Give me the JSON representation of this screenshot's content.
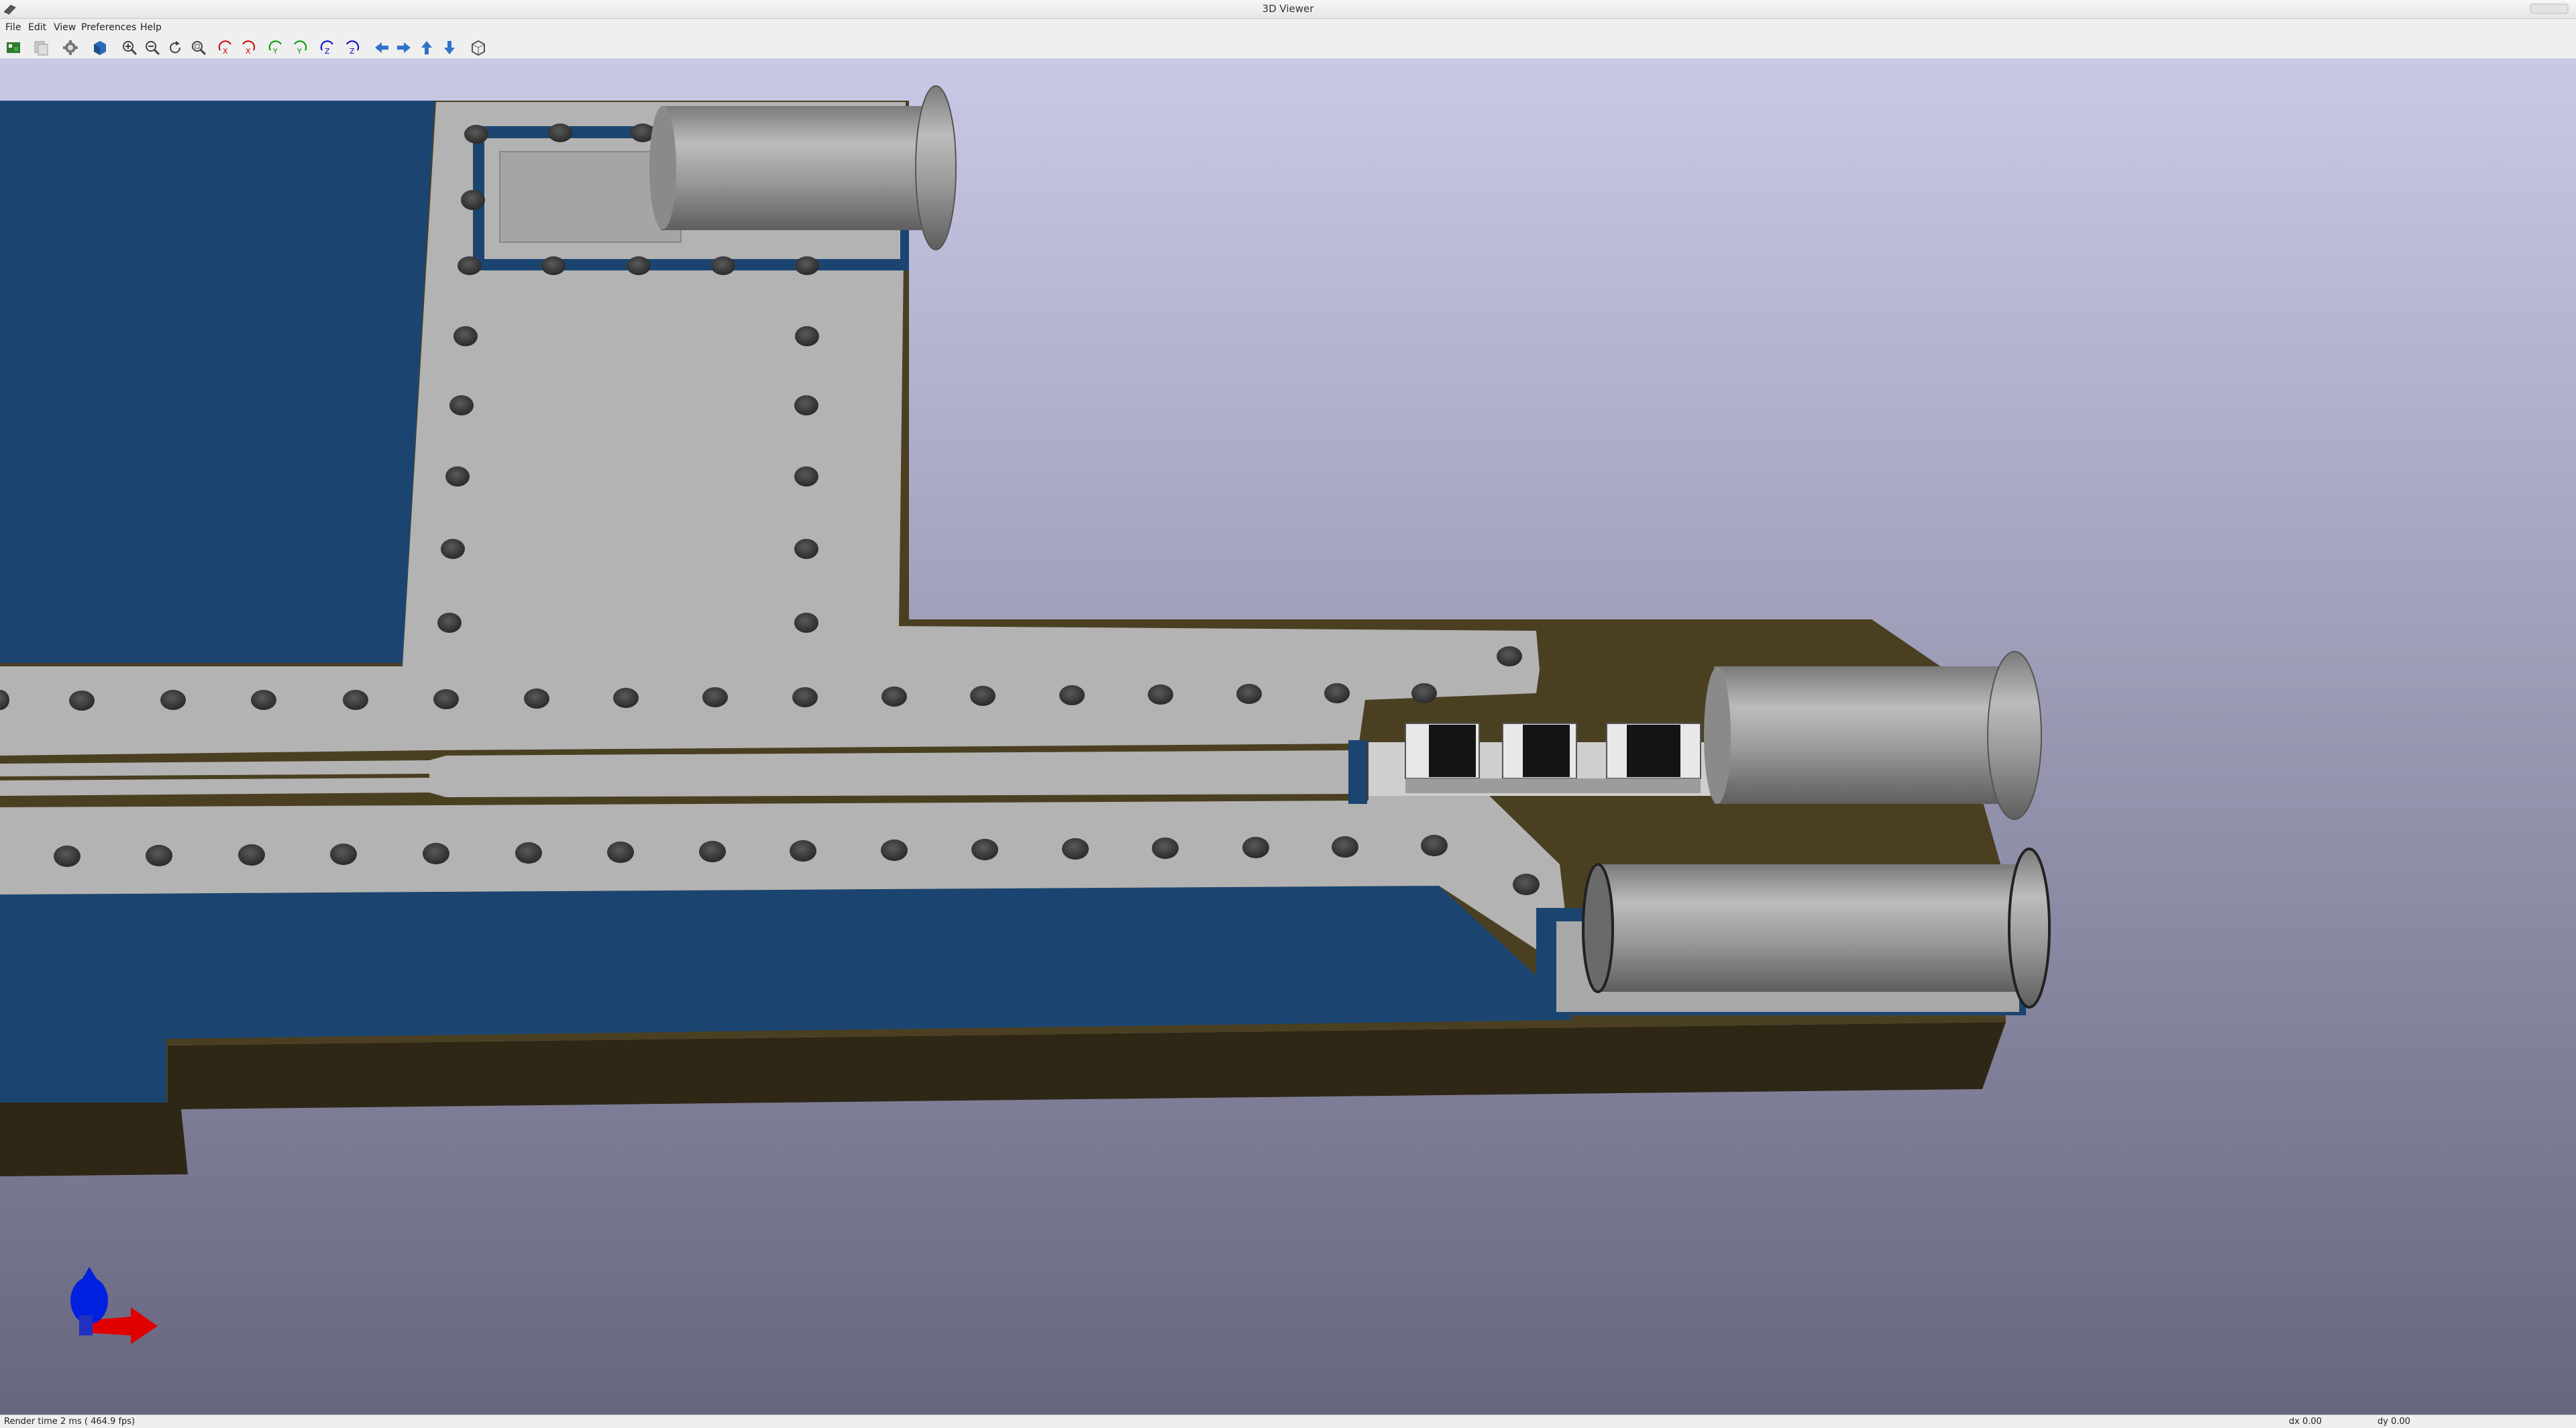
{
  "window": {
    "title": "3D Viewer"
  },
  "menu": [
    {
      "label": "File"
    },
    {
      "label": "Edit"
    },
    {
      "label": "View"
    },
    {
      "label": "Preferences"
    },
    {
      "label": "Help"
    }
  ],
  "toolbar": {
    "buttons": [
      "reload-board-icon",
      "copy-image-icon",
      "render-options-icon",
      "raytrace-icon",
      "zoom-in-icon",
      "zoom-out-icon",
      "redraw-icon",
      "zoom-fit-icon",
      "rotate-x-cw-icon",
      "rotate-x-ccw-icon",
      "rotate-y-cw-icon",
      "rotate-y-ccw-icon",
      "rotate-z-cw-icon",
      "rotate-z-ccw-icon",
      "pan-left-icon",
      "pan-right-icon",
      "pan-up-icon",
      "pan-down-icon",
      "ortho-toggle-icon"
    ]
  },
  "status": {
    "render": "Render time 2 ms ( 464.9 fps)",
    "dx": "dx 0.00",
    "dy": "dy 0.00"
  },
  "colors": {
    "background_top": "#c9c9e6",
    "background_bottom": "#67667f",
    "soldermask": "#1b4570",
    "copper": "#b3b3b3",
    "board_body": "#4b3f22",
    "board_edge": "#2f2716",
    "connector": "#9a9a9a",
    "axis_x": "#e00000",
    "axis_y": "#00a000",
    "axis_z": "#0000e0"
  }
}
